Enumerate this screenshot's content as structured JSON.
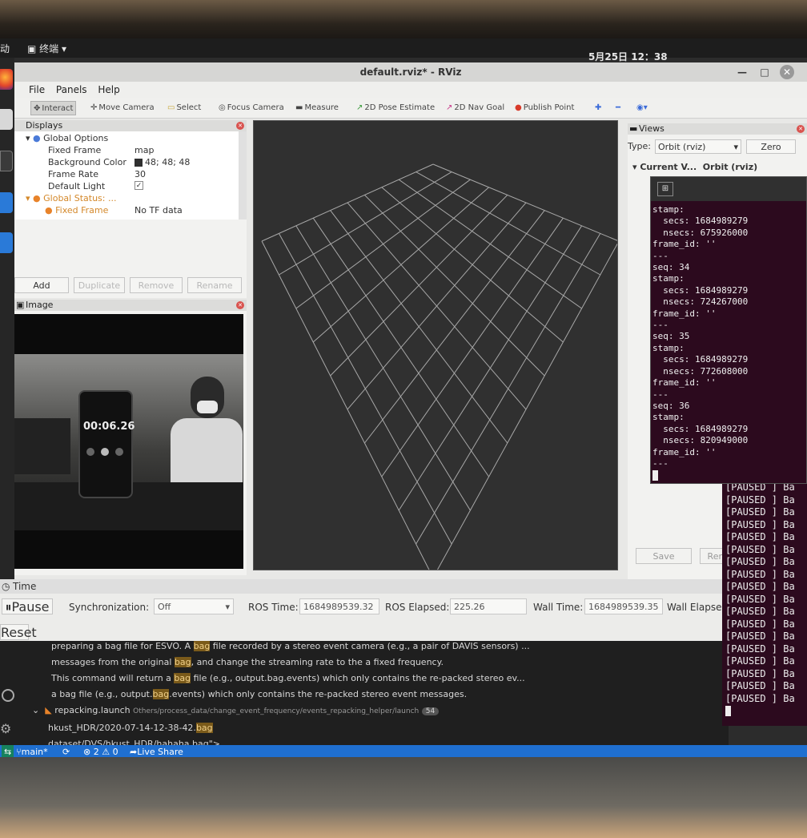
{
  "topbar": {
    "activities": "动",
    "terminal_app": "终端",
    "clock": "5月25日 12：38"
  },
  "rviz": {
    "title": "default.rviz* - RViz",
    "menu": [
      "File",
      "Panels",
      "Help"
    ],
    "tools": [
      "Interact",
      "Move Camera",
      "Select",
      "Focus Camera",
      "Measure",
      "2D Pose Estimate",
      "2D Nav Goal",
      "Publish Point"
    ],
    "displays": {
      "title": "Displays",
      "rows": [
        {
          "key": "Global Options",
          "value": ""
        },
        {
          "key": "Fixed Frame",
          "value": "map"
        },
        {
          "key": "Background Color",
          "value": "48; 48; 48"
        },
        {
          "key": "Frame Rate",
          "value": "30"
        },
        {
          "key": "Default Light",
          "value": "✓"
        },
        {
          "key": "Global Status: ...",
          "value": ""
        },
        {
          "key": "Fixed Frame",
          "value": "No TF data"
        }
      ],
      "buttons": [
        "Add",
        "Duplicate",
        "Remove",
        "Rename"
      ]
    },
    "image_panel": {
      "title": "Image",
      "phone_timer": "00:06.26"
    },
    "views": {
      "title": "Views",
      "type_label": "Type:",
      "type_value": "Orbit (rviz)",
      "zero_button": "Zero",
      "current_label": "Current V...",
      "current_value": "Orbit (rviz)",
      "save_button": "Save",
      "rename_button": "Ren"
    }
  },
  "time_panel": {
    "title": "Time",
    "pause_button": "Pause",
    "sync_label": "Synchronization:",
    "sync_value": "Off",
    "ros_time_label": "ROS Time:",
    "ros_time_value": "1684989539.32",
    "ros_elapsed_label": "ROS Elapsed:",
    "ros_elapsed_value": "225.26",
    "wall_time_label": "Wall Time:",
    "wall_time_value": "1684989539.35",
    "wall_elapsed_label": "Wall Elapsed",
    "reset_button": "Reset"
  },
  "terminal": {
    "lines": [
      "stamp:",
      "  secs: 1684989279",
      "  nsecs: 675926000",
      "frame_id: ''",
      "---",
      "seq: 34",
      "stamp:",
      "  secs: 1684989279",
      "  nsecs: 724267000",
      "frame_id: ''",
      "---",
      "seq: 35",
      "stamp:",
      "  secs: 1684989279",
      "  nsecs: 772608000",
      "frame_id: ''",
      "---",
      "seq: 36",
      "stamp:",
      "  secs: 1684989279",
      "  nsecs: 820949000",
      "frame_id: ''",
      "---"
    ]
  },
  "bag_terminal": {
    "status": "[PAUSED ]",
    "suffix": "Ba",
    "count": 18
  },
  "vscode": {
    "lines": [
      {
        "pre": "preparing a bag file for ESVO. A ",
        "hl": "bag",
        "post": " file recorded by a stereo event camera (e.g., a pair of DAVIS sensors) ..."
      },
      {
        "pre": "messages from the original ",
        "hl": "bag",
        "post": ", and change the streaming rate to the a fixed frequency."
      },
      {
        "pre": "This command will return a ",
        "hl": "bag",
        "post": " file (e.g., output.bag.events) which only contains the re-packed stereo ev..."
      },
      {
        "pre": "a bag file (e.g., output.",
        "hl": "bag",
        "post": ".events) which only contains the re-packed stereo event messages."
      }
    ],
    "file_name": "repacking.launch",
    "file_path": "Others/process_data/change_event_frequency/events_repacking_helper/launch",
    "file_count": "54",
    "line5_pre": "hkust_HDR/2020-07-14-12-38-42.",
    "line5_hl": "bag",
    "line6": "dataset/DVS/hkust_HDR/hahaha.bag\">",
    "status_branch": "main*",
    "status_problems": "⊗ 2 ⚠ 0",
    "status_liveshare": "Live Share"
  }
}
